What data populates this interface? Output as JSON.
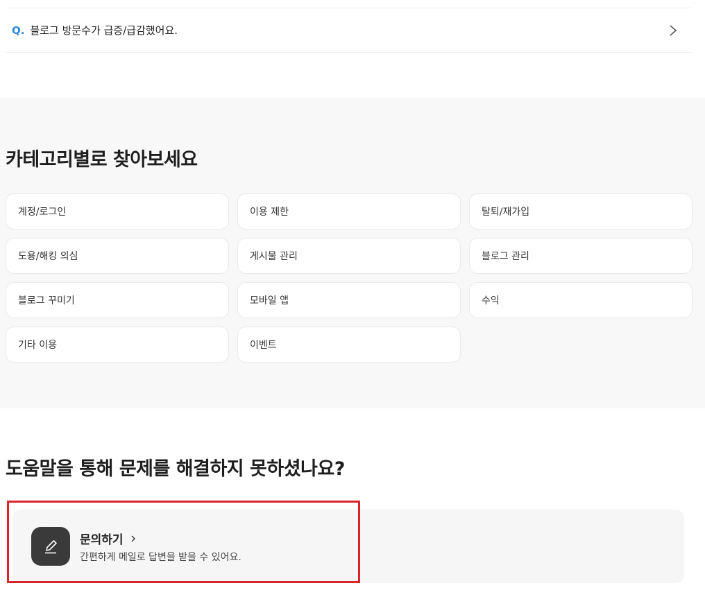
{
  "faq": {
    "q_marker": "Q.",
    "question": "블로그 방문수가 급증/급감했어요."
  },
  "categories": {
    "title": "카테고리별로 찾아보세요",
    "items": [
      {
        "label": "계정/로그인"
      },
      {
        "label": "이용 제한"
      },
      {
        "label": "탈퇴/재가입"
      },
      {
        "label": "도용/해킹 의심"
      },
      {
        "label": "게시물 관리"
      },
      {
        "label": "블로그 관리"
      },
      {
        "label": "블로그 꾸미기"
      },
      {
        "label": "모바일 앱"
      },
      {
        "label": "수익"
      },
      {
        "label": "기타 이용"
      },
      {
        "label": "이벤트"
      }
    ]
  },
  "help": {
    "title": "도움말을 통해 문제를 해결하지 못하셨나요?",
    "contact": {
      "title": "문의하기",
      "description": "간편하게 메일로 답변을 받을 수 있어요.",
      "icon": "edit-pencil-icon"
    }
  },
  "colors": {
    "q_marker": "#2d87d8",
    "highlight": "#d9242b",
    "section_bg": "#f8f8f8",
    "icon_bg": "#3a3a3a"
  }
}
